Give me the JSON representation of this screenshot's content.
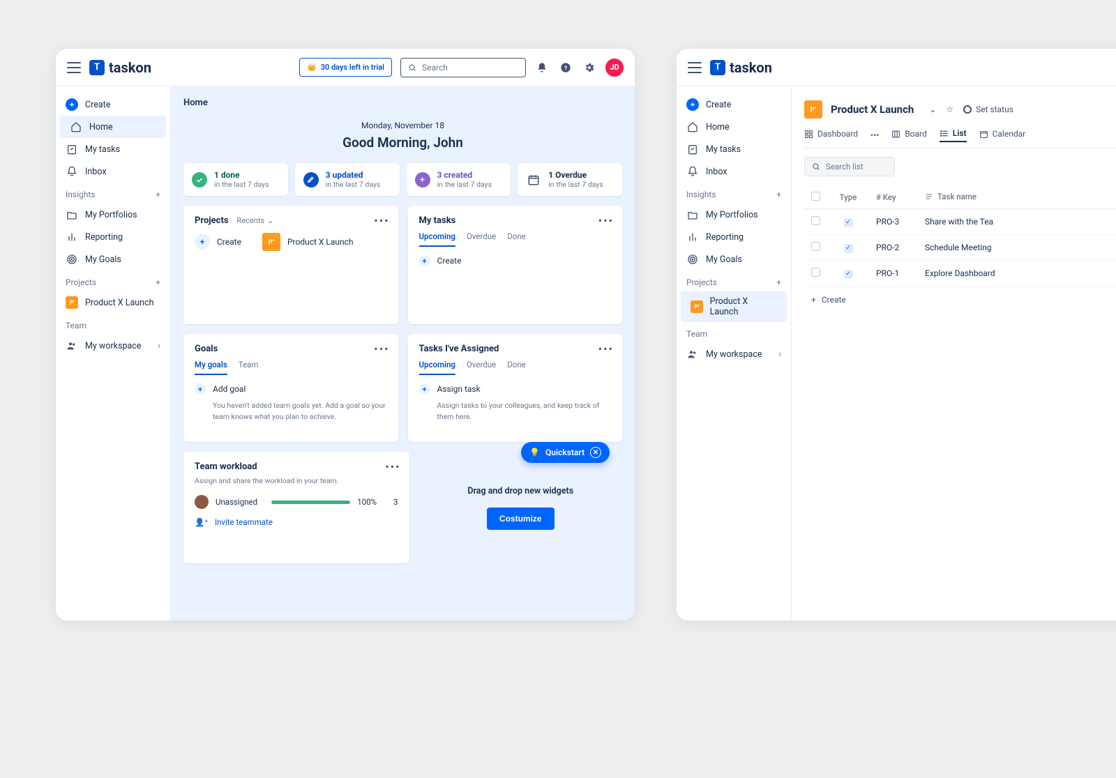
{
  "brand": "taskon",
  "trial_text": "30 days left in trial",
  "search_placeholder": "Search",
  "avatar_initials": "JD",
  "sidebar": {
    "create": "Create",
    "home": "Home",
    "my_tasks": "My tasks",
    "inbox": "Inbox",
    "insights_label": "Insights",
    "portfolios": "My Portfolios",
    "reporting": "Reporting",
    "goals": "My Goals",
    "projects_label": "Projects",
    "project_name": "Product X Launch",
    "team_label": "Team",
    "workspace": "My workspace"
  },
  "home": {
    "breadcrumb": "Home",
    "date": "Monday, November 18",
    "greeting": "Good Morning, John",
    "stats": [
      {
        "title": "1 done",
        "sub": "in the last 7 days"
      },
      {
        "title": "3 updated",
        "sub": "in the last 7 days"
      },
      {
        "title": "3 created",
        "sub": "in the last 7 days"
      },
      {
        "title": "1 Overdue",
        "sub": "in the last 7 days"
      }
    ],
    "projects_card": {
      "title": "Projects",
      "filter": "Recents",
      "create": "Create",
      "project": "Product X Launch"
    },
    "mytasks_card": {
      "title": "My tasks",
      "tabs": [
        "Upcoming",
        "Overdue",
        "Done"
      ],
      "create": "Create"
    },
    "goals_card": {
      "title": "Goals",
      "tabs": [
        "My goals",
        "Team"
      ],
      "add": "Add goal",
      "hint": "You haven't added team goals yet. Add a goal so your team knows what you plan to achieve."
    },
    "assigned_card": {
      "title": "Tasks I've Assigned",
      "tabs": [
        "Upcoming",
        "Overdue",
        "Done"
      ],
      "assign": "Assign task",
      "hint": "Assign tasks to your colleagues, and keep track of them here."
    },
    "workload_card": {
      "title": "Team workload",
      "sub": "Assign and share the workload in your team.",
      "member": "Unassigned",
      "percent": "100%",
      "count": "3",
      "invite": "Invite teammate"
    },
    "drop_text": "Drag and drop new widgets",
    "customize": "Costumize",
    "quickstart": "Quickstart"
  },
  "project_view": {
    "title": "Product X Launch",
    "set_status": "Set status",
    "views": {
      "dashboard": "Dashboard",
      "board": "Board",
      "list": "List",
      "calendar": "Calendar"
    },
    "search_placeholder": "Search list",
    "columns": {
      "type": "Type",
      "key": "# Key",
      "task": "Task name"
    },
    "rows": [
      {
        "key": "PRO-3",
        "task": "Share with the Tea"
      },
      {
        "key": "PRO-2",
        "task": "Schedule Meeting"
      },
      {
        "key": "PRO-1",
        "task": "Explore Dashboard"
      }
    ],
    "create": "Create"
  }
}
